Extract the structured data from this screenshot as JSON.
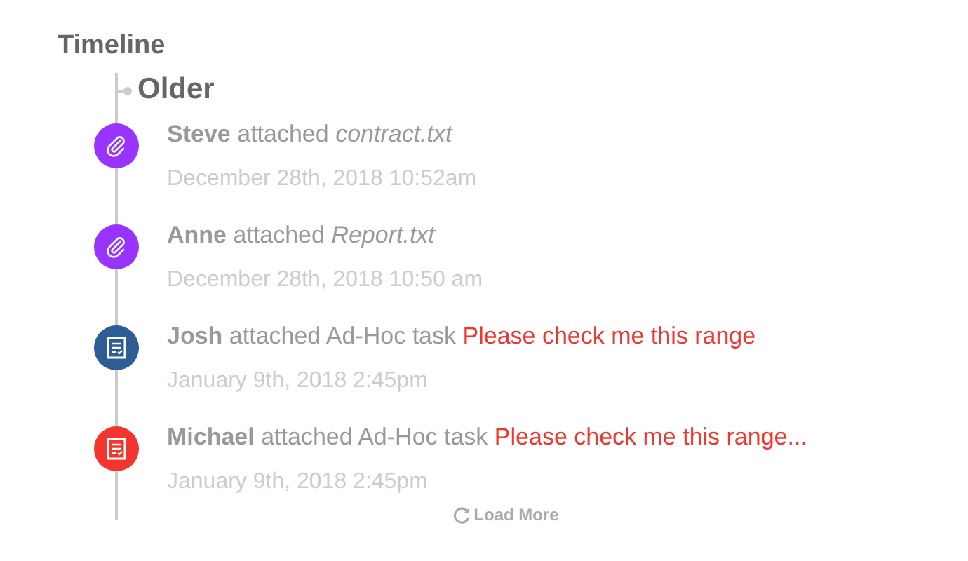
{
  "title": "Timeline",
  "group": "Older",
  "events": [
    {
      "actor": "Steve",
      "action": "attached",
      "target": "contract.txt",
      "kind": "file",
      "date": "December 28th, 2018 10:52am",
      "color": "#9933ff"
    },
    {
      "actor": "Anne",
      "action": "attached",
      "target": "Report.txt",
      "kind": "file",
      "date": "December 28th, 2018 10:50 am",
      "color": "#9933ff"
    },
    {
      "actor": "Josh",
      "action": "attached Ad-Hoc task",
      "target": "Please check me this range",
      "kind": "task",
      "date": "January 9th, 2018 2:45pm",
      "color": "#2e5c94"
    },
    {
      "actor": "Michael",
      "action": "attached Ad-Hoc task",
      "target": "Please check me this range...",
      "kind": "task",
      "date": "January 9th, 2018 2:45pm",
      "color": "#f2352e"
    }
  ],
  "load_more": "Load More"
}
